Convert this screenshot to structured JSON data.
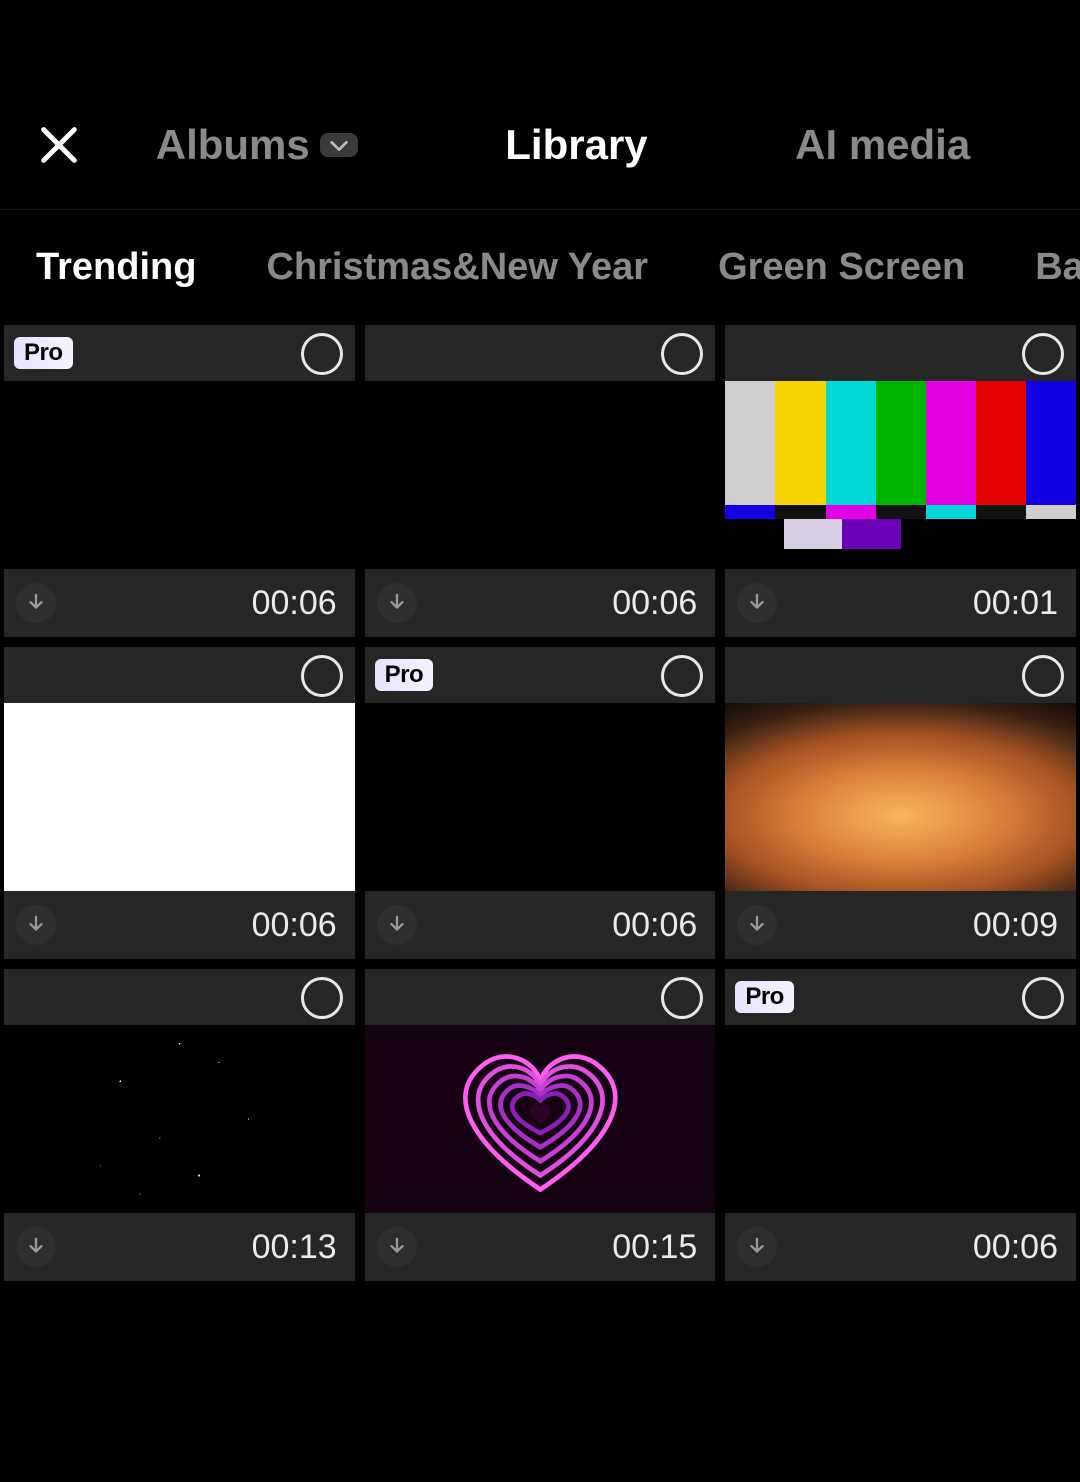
{
  "header": {
    "tabs": {
      "albums": "Albums",
      "library": "Library",
      "ai_media": "AI media"
    },
    "active_tab": "library"
  },
  "categories": [
    {
      "label": "Trending",
      "active": true
    },
    {
      "label": "Christmas&New Year",
      "active": false
    },
    {
      "label": "Green Screen",
      "active": false
    },
    {
      "label": "Background",
      "active": false
    }
  ],
  "badge": {
    "pro": "Pro"
  },
  "clips": [
    {
      "pro": true,
      "duration": "00:06",
      "thumb": "black"
    },
    {
      "pro": false,
      "duration": "00:06",
      "thumb": "black"
    },
    {
      "pro": false,
      "duration": "00:01",
      "thumb": "colorbars"
    },
    {
      "pro": false,
      "duration": "00:06",
      "thumb": "white"
    },
    {
      "pro": true,
      "duration": "00:06",
      "thumb": "black"
    },
    {
      "pro": false,
      "duration": "00:09",
      "thumb": "explosion"
    },
    {
      "pro": false,
      "duration": "00:13",
      "thumb": "stars"
    },
    {
      "pro": false,
      "duration": "00:15",
      "thumb": "hearts"
    },
    {
      "pro": true,
      "duration": "00:06",
      "thumb": "black"
    }
  ]
}
